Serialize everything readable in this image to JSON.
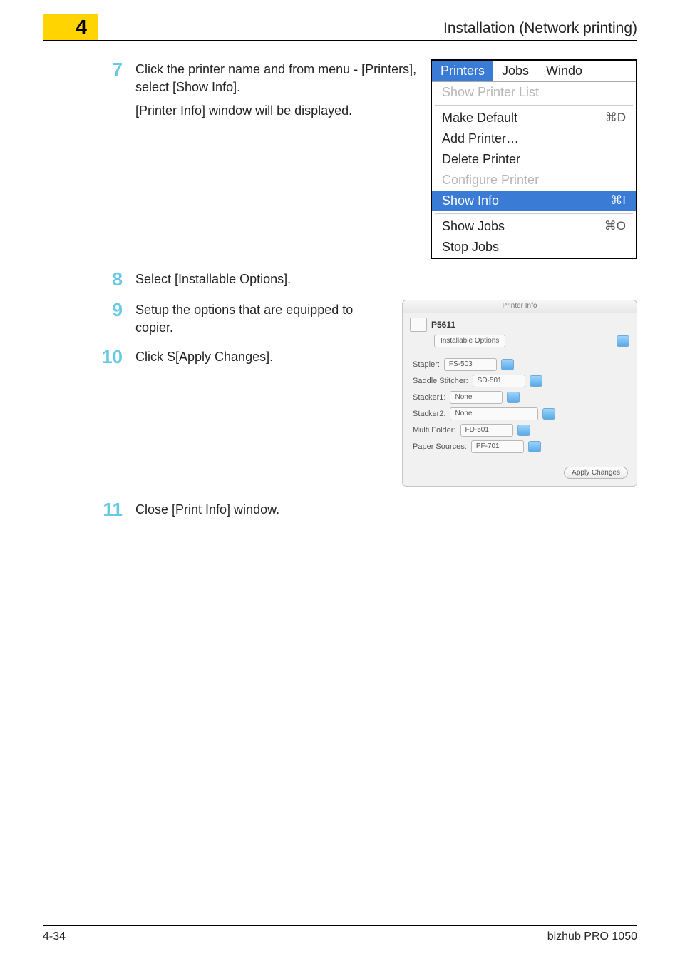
{
  "header": {
    "chapter_number": "4",
    "title": "Installation (Network printing)"
  },
  "steps": {
    "s7": {
      "num": "7",
      "line1": "Click the printer name and from menu - [Printers], select [Show Info].",
      "line2": "[Printer Info] window will be displayed."
    },
    "s8": {
      "num": "8",
      "text": "Select [Installable Options]."
    },
    "s9": {
      "num": "9",
      "text": "Setup the options that are equipped to copier."
    },
    "s10": {
      "num": "10",
      "text": "Click S[Apply Changes]."
    },
    "s11": {
      "num": "11",
      "text": "Close [Print Info] window."
    }
  },
  "mac_menu": {
    "menubar": {
      "printers": "Printers",
      "jobs": "Jobs",
      "window": "Windo"
    },
    "items": {
      "show_list": "Show Printer List",
      "make_default": "Make Default",
      "make_default_sc": "⌘D",
      "add_printer": "Add Printer…",
      "delete_printer": "Delete Printer",
      "configure": "Configure Printer",
      "show_info": "Show Info",
      "show_info_sc": "⌘I",
      "show_jobs": "Show Jobs",
      "show_jobs_sc": "⌘O",
      "stop_jobs": "Stop Jobs"
    }
  },
  "printer_info": {
    "wintitle": "Printer Info",
    "model": "P5611",
    "tab": "Installable Options",
    "fields": {
      "stapler_label": "Stapler:",
      "stapler_value": "FS-503",
      "saddle_label": "Saddle Stitcher:",
      "saddle_value": "SD-501",
      "stacker1_label": "Stacker1:",
      "stacker1_value": "None",
      "stacker2_label": "Stacker2:",
      "stacker2_value": "None",
      "folder_label": "Multi Folder:",
      "folder_value": "FD-501",
      "paper_label": "Paper Sources:",
      "paper_value": "PF-701"
    },
    "apply": "Apply Changes"
  },
  "footer": {
    "page": "4-34",
    "product": "bizhub PRO 1050"
  }
}
